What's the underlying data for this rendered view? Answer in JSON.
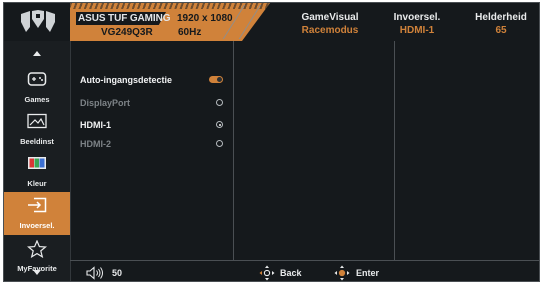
{
  "header": {
    "brand": "ASUS TUF GAMING",
    "model": "VG249Q3R",
    "resolution": "1920 x 1080",
    "refresh": "60Hz",
    "status": [
      {
        "label": "GameVisual",
        "value": "Racemodus"
      },
      {
        "label": "Invoersel.",
        "value": "HDMI-1"
      },
      {
        "label": "Helderheid",
        "value": "65"
      }
    ]
  },
  "sidebar": {
    "items": [
      {
        "label": "Games",
        "icon": "gamepad-icon"
      },
      {
        "label": "Beeldinst",
        "icon": "image-icon"
      },
      {
        "label": "Kleur",
        "icon": "color-bars-icon"
      },
      {
        "label": "Invoersel.",
        "icon": "input-icon",
        "active": true
      },
      {
        "label": "MyFavorite",
        "icon": "star-icon"
      }
    ]
  },
  "options": [
    {
      "label": "Auto-ingangsdetectie",
      "control": "toggle",
      "state": "on"
    },
    {
      "label": "DisplayPort",
      "control": "radio",
      "selected": false,
      "enabled": false
    },
    {
      "label": "HDMI-1",
      "control": "radio",
      "selected": true,
      "enabled": true
    },
    {
      "label": "HDMI-2",
      "control": "radio",
      "selected": false,
      "enabled": false
    }
  ],
  "footer": {
    "volume": "50",
    "back": "Back",
    "enter": "Enter"
  },
  "colors": {
    "accent": "#d0823a",
    "background": "#15191c",
    "text": "#e9ebec",
    "disabled": "#7d8387"
  }
}
